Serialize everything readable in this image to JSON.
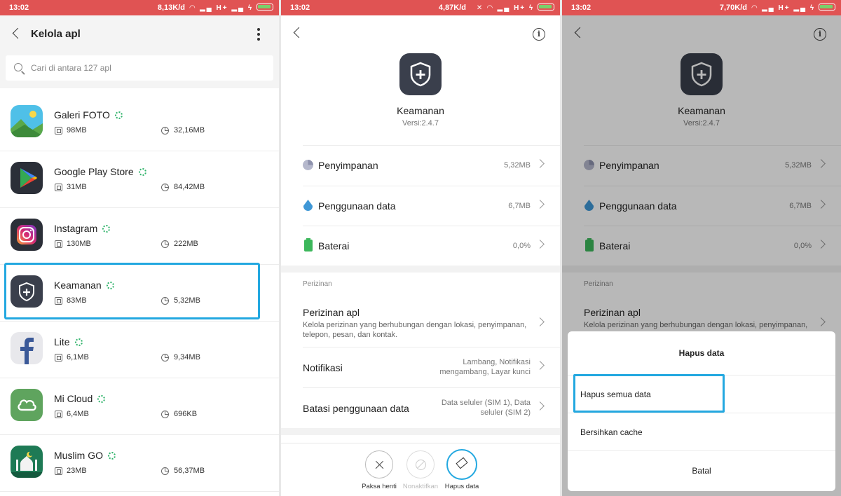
{
  "status": [
    {
      "time": "13:02",
      "speed": "8,13K/d",
      "net": "H+"
    },
    {
      "time": "13:02",
      "speed": "4,87K/d",
      "net": "H+"
    },
    {
      "time": "13:02",
      "speed": "7,70K/d",
      "net": "H+"
    }
  ],
  "manage": {
    "title": "Kelola apl",
    "search_placeholder": "Cari di antara 127 apl",
    "apps": [
      {
        "name": "Galeri FOTO",
        "ram": "98MB",
        "storage": "32,16MB",
        "icon": "gallery-icon"
      },
      {
        "name": "Google Play Store",
        "ram": "31MB",
        "storage": "84,42MB",
        "icon": "play-store-icon"
      },
      {
        "name": "Instagram",
        "ram": "130MB",
        "storage": "222MB",
        "icon": "instagram-icon"
      },
      {
        "name": "Keamanan",
        "ram": "83MB",
        "storage": "5,32MB",
        "icon": "security-shield-icon"
      },
      {
        "name": "Lite",
        "ram": "6,1MB",
        "storage": "9,34MB",
        "icon": "facebook-lite-icon"
      },
      {
        "name": "Mi Cloud",
        "ram": "6,4MB",
        "storage": "696KB",
        "icon": "cloud-icon"
      },
      {
        "name": "Muslim GO",
        "ram": "23MB",
        "storage": "56,37MB",
        "icon": "mosque-icon"
      }
    ]
  },
  "detail": {
    "app_name": "Keamanan",
    "version": "Versi:2.4.7",
    "rows": [
      {
        "label": "Penyimpanan",
        "value": "5,32MB",
        "icon": "storage-pie-icon"
      },
      {
        "label": "Penggunaan data",
        "value": "6,7MB",
        "icon": "water-drop-icon"
      },
      {
        "label": "Baterai",
        "value": "0,0%",
        "icon": "battery-icon"
      }
    ],
    "section_label": "Perizinan",
    "perm_title": "Perizinan apl",
    "perm_sub": "Kelola perizinan yang berhubungan dengan lokasi, penyimpanan, telepon, pesan, dan kontak.",
    "notif_title": "Notifikasi",
    "notif_value": "Lambang, Notifikasi mengambang, Layar kunci",
    "limit_title": "Batasi penggunaan data",
    "limit_value": "Data seluler (SIM 1), Data seluler (SIM 2)",
    "buttons": {
      "force_stop": "Paksa henti",
      "disable": "Nonaktifkan",
      "clear_data": "Hapus data"
    }
  },
  "dialog": {
    "title": "Hapus data",
    "option_all": "Hapus semua data",
    "option_cache": "Bersihkan cache",
    "cancel": "Batal"
  },
  "colors": {
    "status_bar": "#e05353",
    "highlight": "#23a8e0",
    "progress_green": "#2fb36a"
  }
}
